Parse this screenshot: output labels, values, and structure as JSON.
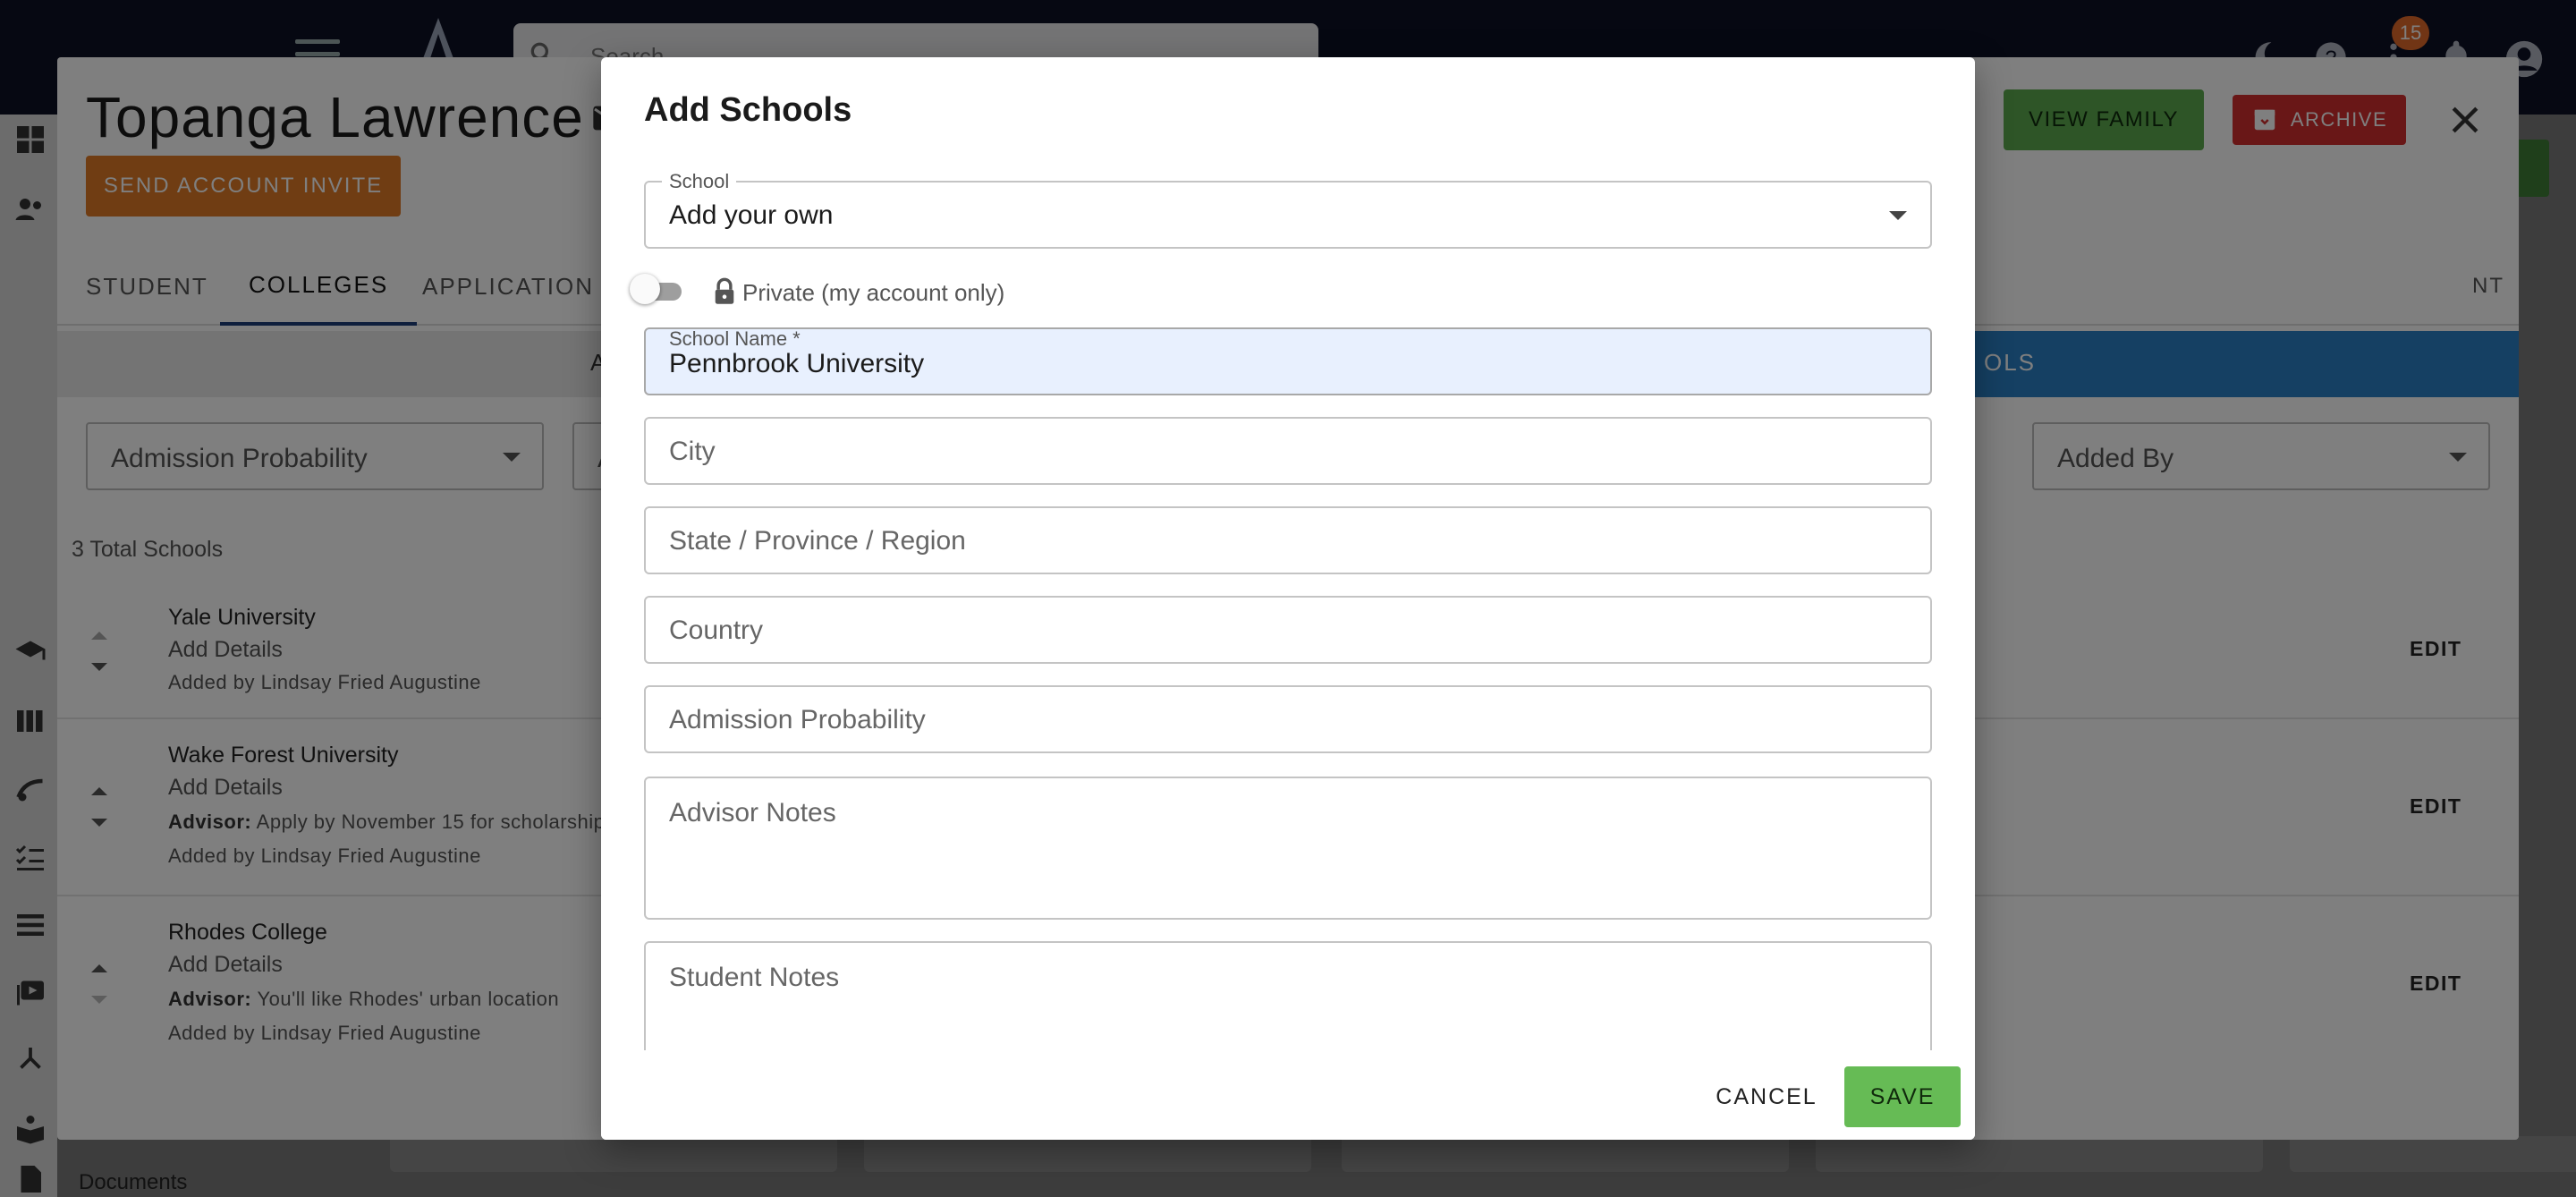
{
  "app": {
    "search_placeholder": "Search",
    "notification_count": "15",
    "documents_label": "Documents"
  },
  "student": {
    "name": "Topanga Lawrence",
    "send_invite_label": "SEND ACCOUNT INVITE",
    "view_family_label": "VIEW FAMILY",
    "archive_label": "ARCHIVE",
    "tabs": [
      {
        "label": "STUDENT"
      },
      {
        "label": "COLLEGES"
      },
      {
        "label": "APPLICATION TR"
      }
    ],
    "tab_right_partial": "NT",
    "subtab_left_partial": "A",
    "subtab_right_partial": "OLS",
    "filters": {
      "admission_probability": "Admission Probability",
      "second_partial": "A",
      "added_by": "Added By"
    },
    "total_schools": "3 Total Schools",
    "schools": [
      {
        "name": "Yale University",
        "details": "Add Details",
        "advisor_label": "",
        "advisor_note": "",
        "added_by": "Added by Lindsay Fried Augustine",
        "edit": "EDIT"
      },
      {
        "name": "Wake Forest University",
        "details": "Add Details",
        "advisor_label": "Advisor:",
        "advisor_note": "Apply by November 15 for scholarship",
        "added_by": "Added by Lindsay Fried Augustine",
        "edit": "EDIT"
      },
      {
        "name": "Rhodes College",
        "details": "Add Details",
        "advisor_label": "Advisor:",
        "advisor_note": "You'll like Rhodes' urban location",
        "added_by": "Added by Lindsay Fried Augustine",
        "edit": "EDIT"
      }
    ]
  },
  "dialog": {
    "title": "Add Schools",
    "school_select": {
      "label": "School",
      "value": "Add your own"
    },
    "private_toggle": {
      "label": "Private (my account only)",
      "checked": false
    },
    "school_name": {
      "label": "School Name *",
      "value": "Pennbrook University"
    },
    "city": {
      "placeholder": "City"
    },
    "state": {
      "placeholder": "State / Province / Region"
    },
    "country": {
      "placeholder": "Country"
    },
    "admission_probability": {
      "placeholder": "Admission Probability"
    },
    "advisor_notes": {
      "placeholder": "Advisor Notes"
    },
    "student_notes": {
      "placeholder": "Student Notes"
    },
    "cancel_label": "CANCEL",
    "save_label": "SAVE"
  },
  "colors": {
    "app_bar": "#0d1024",
    "send_invite": "#e07a26",
    "view_family": "#5cab4e",
    "archive": "#d32f2f",
    "save": "#66bb55",
    "active_subtab": "#2b80c6",
    "autofill_bg": "#e8f0fe"
  }
}
